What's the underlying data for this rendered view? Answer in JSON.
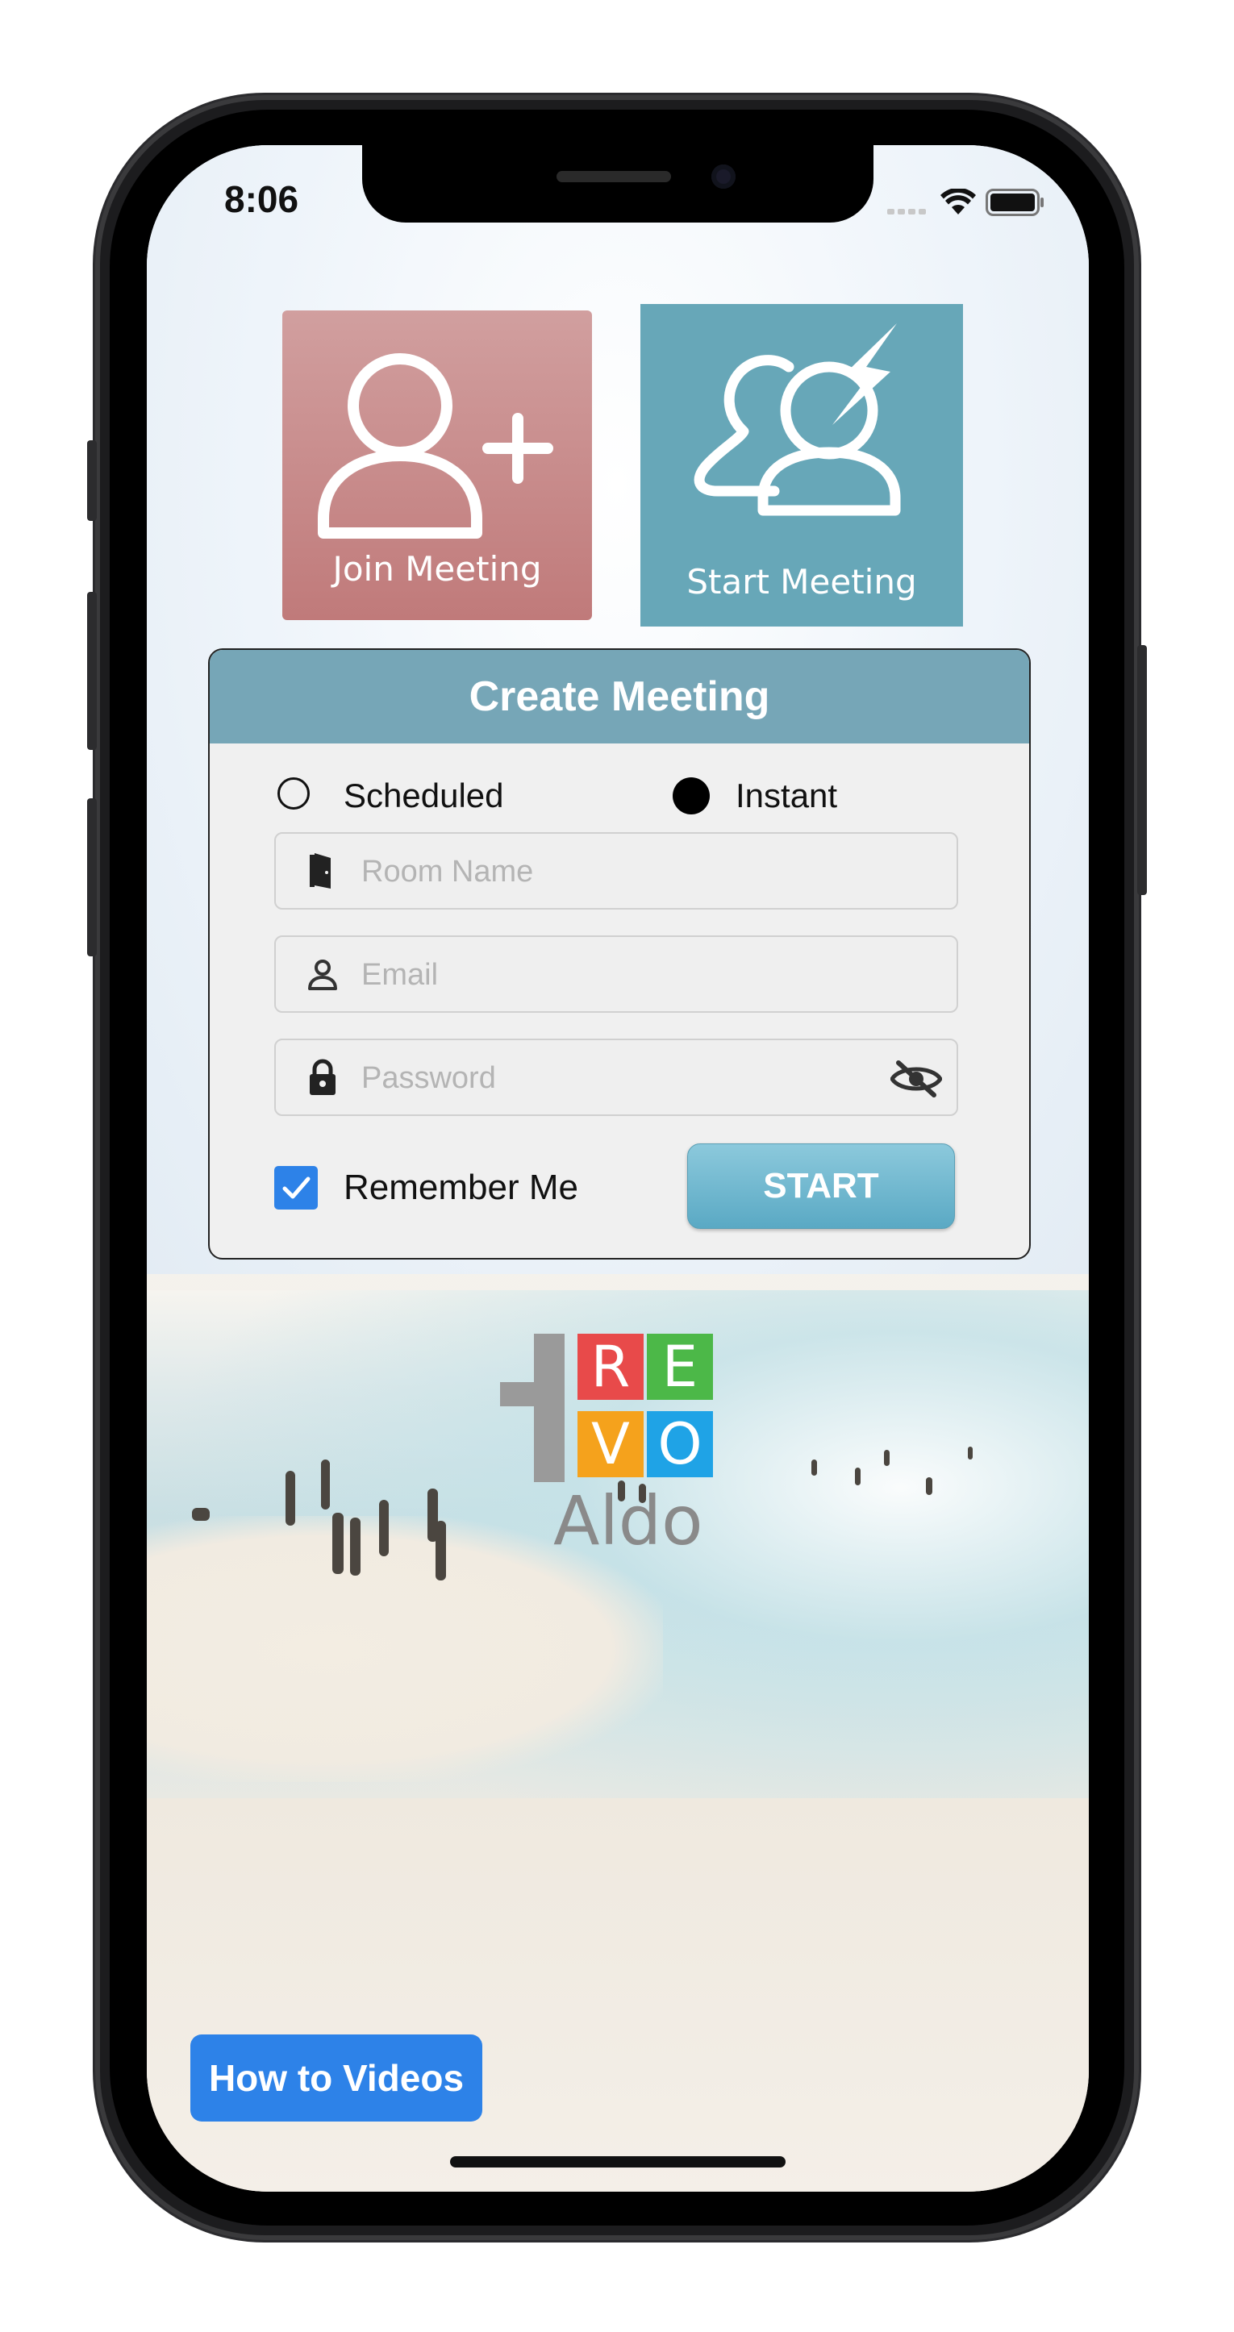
{
  "status_bar": {
    "time": "8:06"
  },
  "tiles": {
    "join_label": "Join Meeting",
    "start_label": "Start Meeting"
  },
  "form": {
    "title": "Create Meeting",
    "radio_scheduled": "Scheduled",
    "radio_instant": "Instant",
    "selected_mode": "Instant",
    "room_placeholder": "Room Name",
    "email_placeholder": "Email",
    "password_placeholder": "Password",
    "remember_label": "Remember Me",
    "remember_checked": true,
    "start_label": "START"
  },
  "logo": {
    "letters": [
      "R",
      "E",
      "V",
      "O"
    ],
    "word": "Aldo",
    "colors": [
      "#e84a4a",
      "#4cb848",
      "#f5a21c",
      "#1fa3e6"
    ]
  },
  "footer": {
    "howto_label": "How to Videos"
  },
  "colors": {
    "join_tile": "#c58585",
    "start_tile": "#67a7b8",
    "header": "#76a6b7",
    "accent_blue": "#2d82e8"
  }
}
